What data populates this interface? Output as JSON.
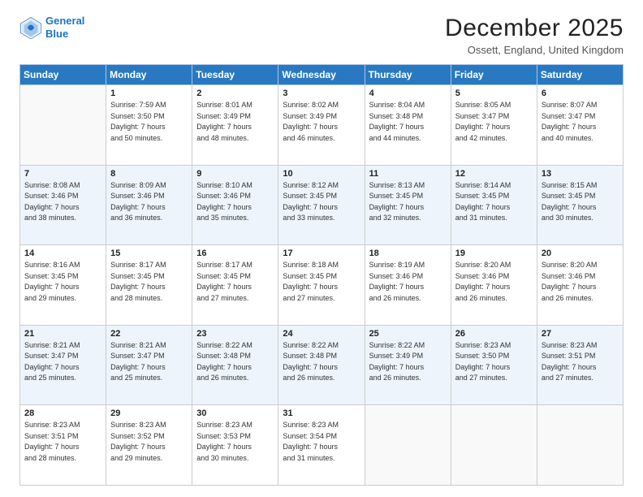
{
  "logo": {
    "line1": "General",
    "line2": "Blue"
  },
  "title": "December 2025",
  "subtitle": "Ossett, England, United Kingdom",
  "weekdays": [
    "Sunday",
    "Monday",
    "Tuesday",
    "Wednesday",
    "Thursday",
    "Friday",
    "Saturday"
  ],
  "weeks": [
    [
      {
        "day": "",
        "info": ""
      },
      {
        "day": "1",
        "info": "Sunrise: 7:59 AM\nSunset: 3:50 PM\nDaylight: 7 hours\nand 50 minutes."
      },
      {
        "day": "2",
        "info": "Sunrise: 8:01 AM\nSunset: 3:49 PM\nDaylight: 7 hours\nand 48 minutes."
      },
      {
        "day": "3",
        "info": "Sunrise: 8:02 AM\nSunset: 3:49 PM\nDaylight: 7 hours\nand 46 minutes."
      },
      {
        "day": "4",
        "info": "Sunrise: 8:04 AM\nSunset: 3:48 PM\nDaylight: 7 hours\nand 44 minutes."
      },
      {
        "day": "5",
        "info": "Sunrise: 8:05 AM\nSunset: 3:47 PM\nDaylight: 7 hours\nand 42 minutes."
      },
      {
        "day": "6",
        "info": "Sunrise: 8:07 AM\nSunset: 3:47 PM\nDaylight: 7 hours\nand 40 minutes."
      }
    ],
    [
      {
        "day": "7",
        "info": "Sunrise: 8:08 AM\nSunset: 3:46 PM\nDaylight: 7 hours\nand 38 minutes."
      },
      {
        "day": "8",
        "info": "Sunrise: 8:09 AM\nSunset: 3:46 PM\nDaylight: 7 hours\nand 36 minutes."
      },
      {
        "day": "9",
        "info": "Sunrise: 8:10 AM\nSunset: 3:46 PM\nDaylight: 7 hours\nand 35 minutes."
      },
      {
        "day": "10",
        "info": "Sunrise: 8:12 AM\nSunset: 3:45 PM\nDaylight: 7 hours\nand 33 minutes."
      },
      {
        "day": "11",
        "info": "Sunrise: 8:13 AM\nSunset: 3:45 PM\nDaylight: 7 hours\nand 32 minutes."
      },
      {
        "day": "12",
        "info": "Sunrise: 8:14 AM\nSunset: 3:45 PM\nDaylight: 7 hours\nand 31 minutes."
      },
      {
        "day": "13",
        "info": "Sunrise: 8:15 AM\nSunset: 3:45 PM\nDaylight: 7 hours\nand 30 minutes."
      }
    ],
    [
      {
        "day": "14",
        "info": "Sunrise: 8:16 AM\nSunset: 3:45 PM\nDaylight: 7 hours\nand 29 minutes."
      },
      {
        "day": "15",
        "info": "Sunrise: 8:17 AM\nSunset: 3:45 PM\nDaylight: 7 hours\nand 28 minutes."
      },
      {
        "day": "16",
        "info": "Sunrise: 8:17 AM\nSunset: 3:45 PM\nDaylight: 7 hours\nand 27 minutes."
      },
      {
        "day": "17",
        "info": "Sunrise: 8:18 AM\nSunset: 3:45 PM\nDaylight: 7 hours\nand 27 minutes."
      },
      {
        "day": "18",
        "info": "Sunrise: 8:19 AM\nSunset: 3:46 PM\nDaylight: 7 hours\nand 26 minutes."
      },
      {
        "day": "19",
        "info": "Sunrise: 8:20 AM\nSunset: 3:46 PM\nDaylight: 7 hours\nand 26 minutes."
      },
      {
        "day": "20",
        "info": "Sunrise: 8:20 AM\nSunset: 3:46 PM\nDaylight: 7 hours\nand 26 minutes."
      }
    ],
    [
      {
        "day": "21",
        "info": "Sunrise: 8:21 AM\nSunset: 3:47 PM\nDaylight: 7 hours\nand 25 minutes."
      },
      {
        "day": "22",
        "info": "Sunrise: 8:21 AM\nSunset: 3:47 PM\nDaylight: 7 hours\nand 25 minutes."
      },
      {
        "day": "23",
        "info": "Sunrise: 8:22 AM\nSunset: 3:48 PM\nDaylight: 7 hours\nand 26 minutes."
      },
      {
        "day": "24",
        "info": "Sunrise: 8:22 AM\nSunset: 3:48 PM\nDaylight: 7 hours\nand 26 minutes."
      },
      {
        "day": "25",
        "info": "Sunrise: 8:22 AM\nSunset: 3:49 PM\nDaylight: 7 hours\nand 26 minutes."
      },
      {
        "day": "26",
        "info": "Sunrise: 8:23 AM\nSunset: 3:50 PM\nDaylight: 7 hours\nand 27 minutes."
      },
      {
        "day": "27",
        "info": "Sunrise: 8:23 AM\nSunset: 3:51 PM\nDaylight: 7 hours\nand 27 minutes."
      }
    ],
    [
      {
        "day": "28",
        "info": "Sunrise: 8:23 AM\nSunset: 3:51 PM\nDaylight: 7 hours\nand 28 minutes."
      },
      {
        "day": "29",
        "info": "Sunrise: 8:23 AM\nSunset: 3:52 PM\nDaylight: 7 hours\nand 29 minutes."
      },
      {
        "day": "30",
        "info": "Sunrise: 8:23 AM\nSunset: 3:53 PM\nDaylight: 7 hours\nand 30 minutes."
      },
      {
        "day": "31",
        "info": "Sunrise: 8:23 AM\nSunset: 3:54 PM\nDaylight: 7 hours\nand 31 minutes."
      },
      {
        "day": "",
        "info": ""
      },
      {
        "day": "",
        "info": ""
      },
      {
        "day": "",
        "info": ""
      }
    ]
  ]
}
